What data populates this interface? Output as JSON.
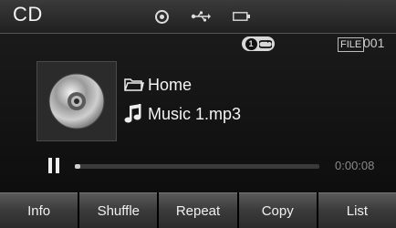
{
  "status_bar": {
    "mode": "CD",
    "icons": [
      "disc-icon",
      "usb-icon",
      "battery-icon"
    ]
  },
  "playback": {
    "repeat_badge": "1",
    "file_label": "FILE",
    "file_number": "001",
    "folder_icon": "folder-icon",
    "folder": "Home",
    "track_icon": "music-note-icon",
    "track": "Music 1.mp3",
    "state_icon": "pause-icon",
    "progress_fraction": 0.02,
    "elapsed": "0:00:08"
  },
  "buttons": [
    {
      "label": "Info"
    },
    {
      "label": "Shuffle"
    },
    {
      "label": "Repeat"
    },
    {
      "label": "Copy"
    },
    {
      "label": "List"
    }
  ]
}
